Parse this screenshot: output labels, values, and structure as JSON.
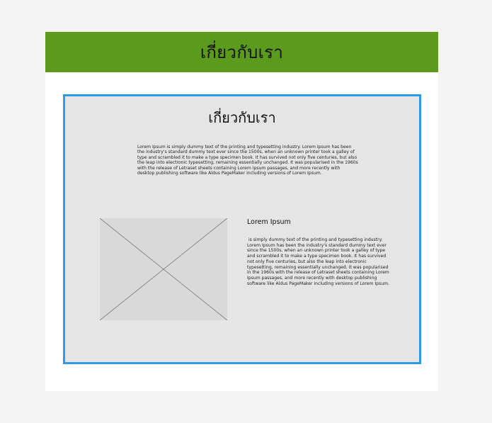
{
  "header": {
    "title": "เกี่ยวกับเรา"
  },
  "content": {
    "title": "เกี่ยวกับเรา",
    "intro": "Lorem Ipsum is simply dummy text of the printing and typesetting industry. Lorem Ipsum has been the industry's standard dummy text ever since the 1500s, when an unknown printer took a galley of type and scrambled it to make a type specimen book. It has survived not only five centuries, but also the leap into electronic typesetting, remaining essentially unchanged. It was popularised in the 1960s with the release of Letraset sheets containing Lorem Ipsum passages, and more recently with desktop publishing software like Aldus PageMaker including versions of Lorem Ipsum.",
    "side_heading": "Lorem Ipsum",
    "side_text": " is simply dummy text of the printing and typesetting industry. Lorem Ipsum has been the industry's standard dummy text ever since the 1500s, when an unknown printer took a galley of type and scrambled it to make a type specimen book. It has survived not only five centuries, but also the leap into electronic typesetting, remaining essentially unchanged. It was popularised in the 1960s with the release of Letraset sheets containing Lorem Ipsum passages, and more recently with desktop publishing software like Aldus PageMaker including versions of Lorem Ipsum."
  },
  "image": {
    "icon": "image-placeholder-icon"
  },
  "colors": {
    "header_background": "#5b9a1d",
    "box_border": "#2f9be8",
    "box_background": "#e5e5e5",
    "placeholder_background": "#d9d9d9"
  }
}
